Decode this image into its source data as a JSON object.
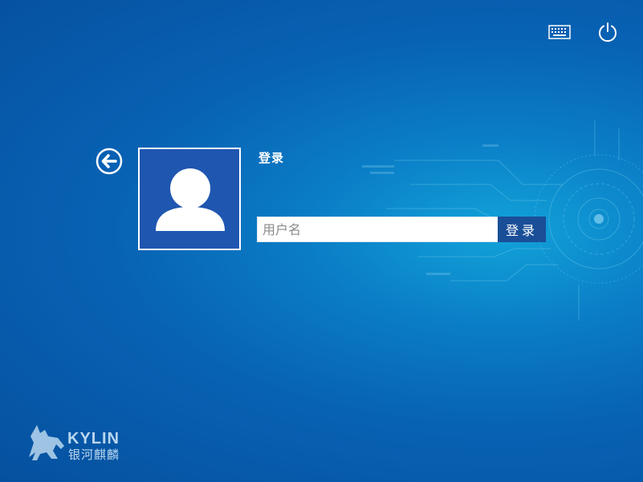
{
  "header": {
    "keyboard_icon": "keyboard-icon",
    "power_icon": "power-icon"
  },
  "login": {
    "title": "登录",
    "username_placeholder": "用户名",
    "username_value": "",
    "button_label": "登录",
    "back_icon": "arrow-left-circle-icon",
    "avatar_icon": "user-silhouette-icon"
  },
  "brand": {
    "name_en": "KYLIN",
    "name_cn": "银河麒麟"
  },
  "colors": {
    "background_dark": "#06509f",
    "background_light": "#12a3d9",
    "avatar_bg": "#1f56b0",
    "button_bg": "#1a4f98",
    "text": "#ffffff"
  }
}
